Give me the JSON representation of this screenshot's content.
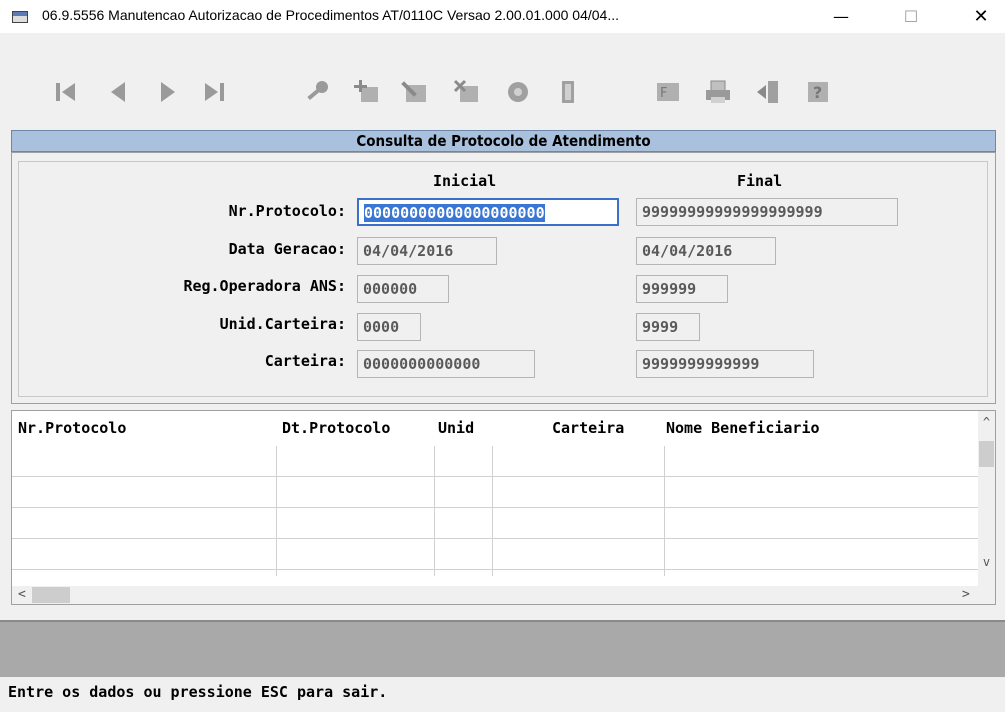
{
  "window": {
    "title": "06.9.5556 Manutencao Autorizacao de Procedimentos AT/0110C Versao 2.00.01.000 04/04...",
    "minimize_glyph": "—",
    "maximize_glyph": "☐",
    "close_glyph": "✕"
  },
  "toolbar": {
    "buttons": [
      {
        "name": "first-record-icon"
      },
      {
        "name": "previous-record-icon"
      },
      {
        "name": "next-record-icon"
      },
      {
        "name": "last-record-icon"
      },
      {
        "name": "search-key-icon"
      },
      {
        "name": "add-record-icon"
      },
      {
        "name": "edit-record-icon"
      },
      {
        "name": "delete-record-icon"
      },
      {
        "name": "copy-record-icon"
      },
      {
        "name": "exit-door-icon"
      },
      {
        "name": "filter-icon"
      },
      {
        "name": "print-icon"
      },
      {
        "name": "navigate-icon"
      },
      {
        "name": "help-icon"
      }
    ]
  },
  "panel": {
    "title": "Consulta de Protocolo de Atendimento",
    "col_initial": "Inicial",
    "col_final": "Final",
    "rows": [
      {
        "label": "Nr.Protocolo:",
        "initial": "00000000000000000000",
        "final": "99999999999999999999"
      },
      {
        "label": "Data Geracao:",
        "initial": "04/04/2016",
        "final": "04/04/2016"
      },
      {
        "label": "Reg.Operadora ANS:",
        "initial": "000000",
        "final": "999999"
      },
      {
        "label": "Unid.Carteira:",
        "initial": "0000",
        "final": "9999"
      },
      {
        "label": "Carteira:",
        "initial": "0000000000000",
        "final": "9999999999999"
      }
    ]
  },
  "grid": {
    "columns": [
      "Nr.Protocolo",
      "Dt.Protocolo",
      "Unid",
      "Carteira",
      "Nome Beneficiario"
    ],
    "scroll_up": "^",
    "scroll_down": "v",
    "scroll_left": "<",
    "scroll_right": ">"
  },
  "status": {
    "message": "Entre os dados ou pressione ESC para sair."
  },
  "colors": {
    "panel_header": "#a9c1dc",
    "selection": "#3a76d4",
    "status_bar": "#a9a9a9"
  }
}
